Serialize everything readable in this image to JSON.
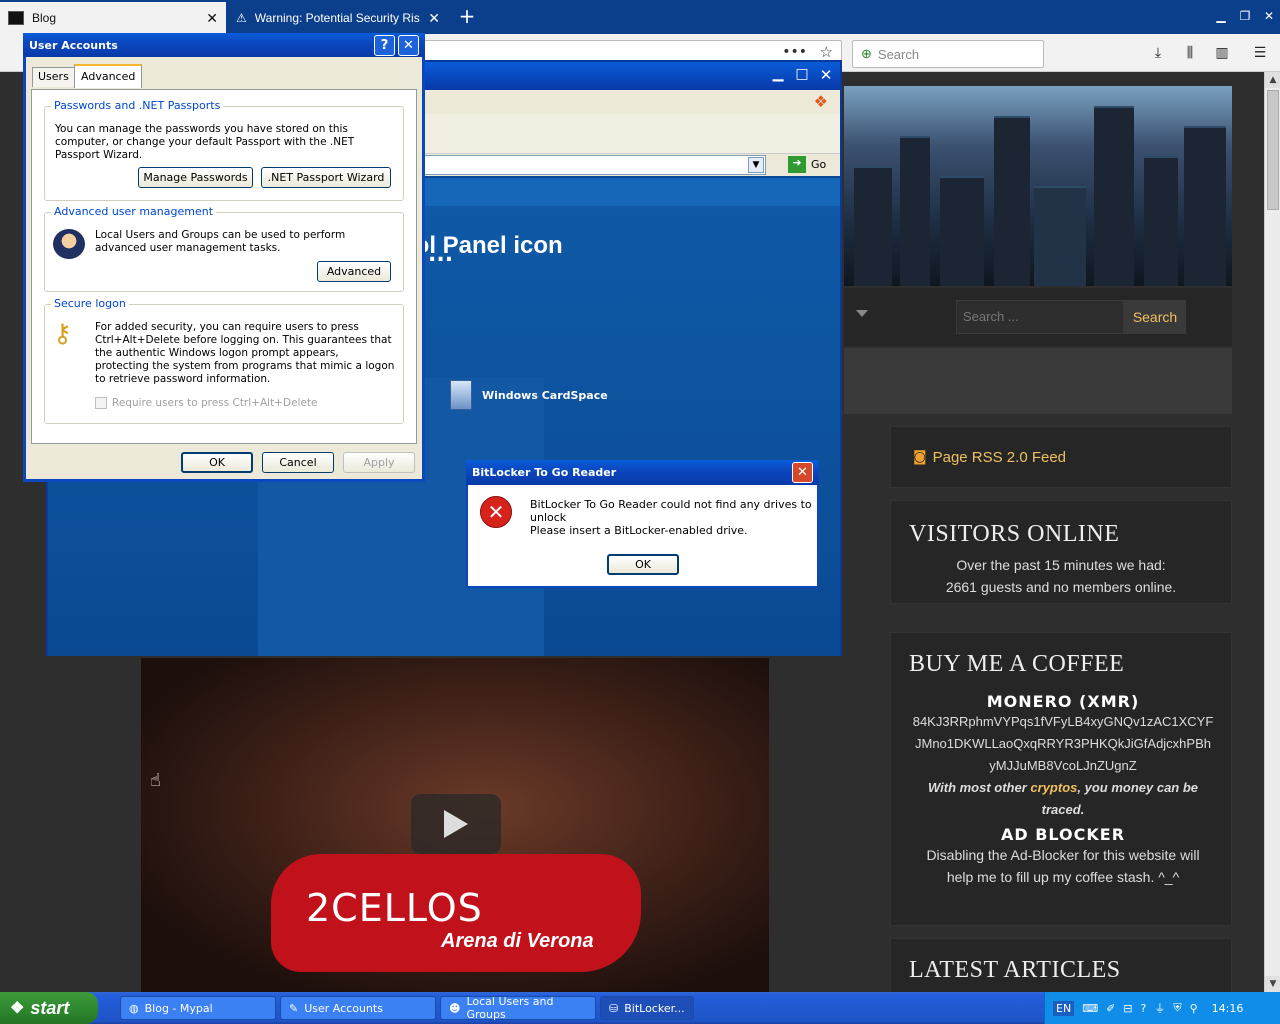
{
  "browser": {
    "tabs": [
      {
        "label": "Blog",
        "active": true
      },
      {
        "label": "Warning: Potential Security Risk A",
        "active": false
      }
    ],
    "search_placeholder": "Search"
  },
  "website": {
    "search_placeholder": "Search ...",
    "search_button": "Search",
    "rss_label": "Page RSS 2.0 Feed",
    "visitors": {
      "title": "VISITORS ONLINE",
      "line1": "Over the past 15 minutes we had:",
      "line2": "2661 guests and no members online."
    },
    "coffee": {
      "title": "BUY ME A COFFEE",
      "monero_label": "MONERO (XMR)",
      "address_1": "84KJ3RRphmVYPqs1fVFyLB4xyGNQv1zAC1XCYF",
      "address_2": "JMno1DKWLLaoQxqRRYR3PHKQkJiGfAdjcxhPBh",
      "address_3": "yMJJuMB8VcoLJnZUgnZ",
      "note_prefix": "With most other ",
      "note_highlight": "cryptos",
      "note_suffix": ", you money can be",
      "note_line2": "traced.",
      "adblock_label": "AD BLOCKER",
      "adblock_1": "Disabling the Ad-Blocker for this website will",
      "adblock_2": "help me to fill up my coffee stash. ^_^"
    },
    "latest_title": "LATEST ARTICLES",
    "video": {
      "title": "2CELLOS",
      "subtitle": "Arena di Verona"
    }
  },
  "control_panel": {
    "go_label": "Go",
    "heading": "ontrol Panel icon",
    "cardspace_label": "Windows CardSpace",
    "ellipsis": "..."
  },
  "user_accounts": {
    "title": "User Accounts",
    "tabs": [
      "Users",
      "Advanced"
    ],
    "passwords_group": "Passwords and .NET Passports",
    "passwords_text": "You can manage the passwords you have stored on this computer, or change your default Passport with the .NET Passport Wizard.",
    "manage_passwords": "Manage Passwords",
    "passport_wizard": ".NET Passport Wizard",
    "advanced_group": "Advanced user management",
    "advanced_text": "Local Users and Groups can be used to perform advanced user management tasks.",
    "advanced_button": "Advanced",
    "secure_group": "Secure logon",
    "secure_text": "For added security, you can require users to press Ctrl+Alt+Delete before logging on. This guarantees that the authentic Windows logon prompt appears, protecting the system from programs that mimic a logon to retrieve password information.",
    "ctrl_alt_del_label": "Require users to press Ctrl+Alt+Delete",
    "ok": "OK",
    "cancel": "Cancel",
    "apply": "Apply"
  },
  "bitlocker": {
    "title": "BitLocker To Go Reader",
    "message1": "BitLocker To Go Reader could not find any drives to unlock",
    "message2": "Please insert a BitLocker-enabled drive.",
    "ok": "OK"
  },
  "taskbar": {
    "start": "start",
    "items": [
      "Blog - Mypal",
      "User Accounts",
      "Local Users and Groups",
      "BitLocker..."
    ],
    "lang": "EN",
    "clock": "14:16"
  },
  "colors": {
    "xp_blue": "#0b48c0",
    "site_accent": "#f0c060",
    "error_red": "#d8231a"
  }
}
